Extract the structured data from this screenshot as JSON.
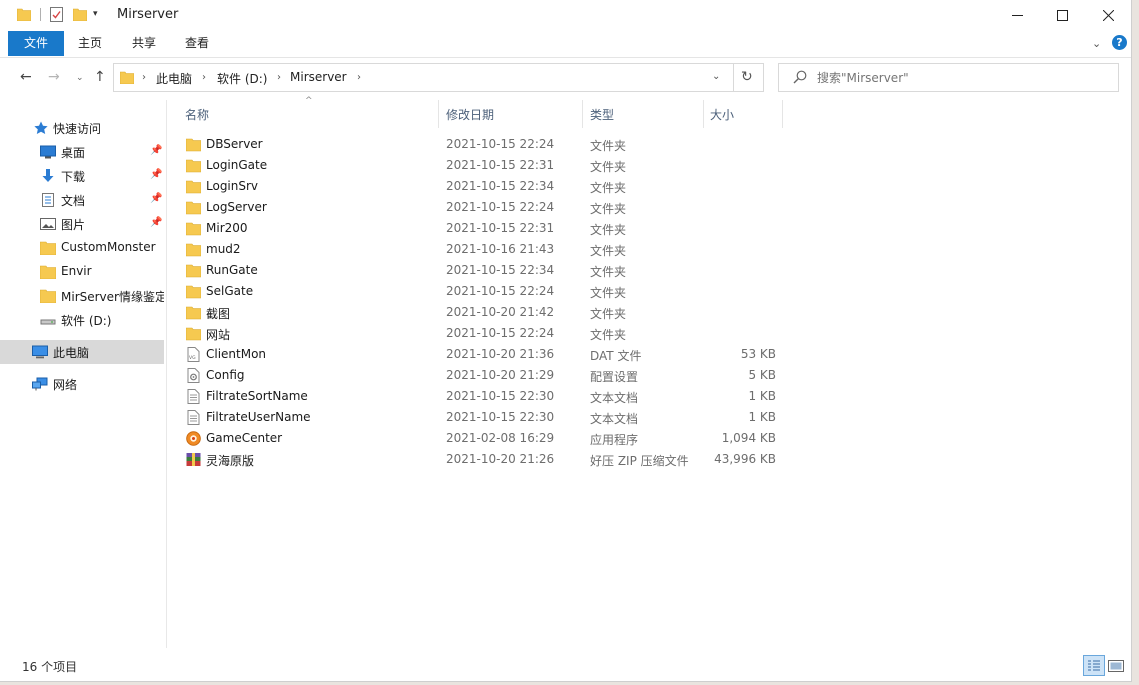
{
  "window": {
    "title": "Mirserver"
  },
  "ribbon": {
    "tabs": [
      "文件",
      "主页",
      "共享",
      "查看"
    ],
    "help_label": "?"
  },
  "address": {
    "crumbs": [
      "此电脑",
      "软件 (D:)",
      "Mirserver"
    ]
  },
  "search": {
    "placeholder": "搜索\"Mirserver\""
  },
  "sidebar": {
    "items": [
      {
        "label": "快速访问",
        "icon": "star-icon"
      },
      {
        "label": "桌面",
        "icon": "desktop-icon",
        "pinned": true
      },
      {
        "label": "下载",
        "icon": "download-icon",
        "pinned": true
      },
      {
        "label": "文档",
        "icon": "document-icon",
        "pinned": true
      },
      {
        "label": "图片",
        "icon": "picture-icon",
        "pinned": true
      },
      {
        "label": "CustomMonster",
        "icon": "folder-icon"
      },
      {
        "label": "Envir",
        "icon": "folder-icon"
      },
      {
        "label": "MirServer情缘鉴定",
        "icon": "folder-icon"
      },
      {
        "label": "软件 (D:)",
        "icon": "drive-icon"
      },
      {
        "label": "此电脑",
        "icon": "computer-icon",
        "selected": true
      },
      {
        "label": "网络",
        "icon": "network-icon"
      }
    ]
  },
  "columns": {
    "name": "名称",
    "date": "修改日期",
    "type": "类型",
    "size": "大小"
  },
  "files": [
    {
      "name": "DBServer",
      "date": "2021-10-15 22:24",
      "type": "文件夹",
      "size": "",
      "icon": "folder-icon"
    },
    {
      "name": "LoginGate",
      "date": "2021-10-15 22:31",
      "type": "文件夹",
      "size": "",
      "icon": "folder-icon"
    },
    {
      "name": "LoginSrv",
      "date": "2021-10-15 22:34",
      "type": "文件夹",
      "size": "",
      "icon": "folder-icon"
    },
    {
      "name": "LogServer",
      "date": "2021-10-15 22:24",
      "type": "文件夹",
      "size": "",
      "icon": "folder-icon"
    },
    {
      "name": "Mir200",
      "date": "2021-10-15 22:31",
      "type": "文件夹",
      "size": "",
      "icon": "folder-icon"
    },
    {
      "name": "mud2",
      "date": "2021-10-16 21:43",
      "type": "文件夹",
      "size": "",
      "icon": "folder-icon"
    },
    {
      "name": "RunGate",
      "date": "2021-10-15 22:34",
      "type": "文件夹",
      "size": "",
      "icon": "folder-icon"
    },
    {
      "name": "SelGate",
      "date": "2021-10-15 22:24",
      "type": "文件夹",
      "size": "",
      "icon": "folder-icon"
    },
    {
      "name": "截图",
      "date": "2021-10-20 21:42",
      "type": "文件夹",
      "size": "",
      "icon": "folder-icon"
    },
    {
      "name": "网站",
      "date": "2021-10-15 22:24",
      "type": "文件夹",
      "size": "",
      "icon": "folder-icon"
    },
    {
      "name": "ClientMon",
      "date": "2021-10-20 21:36",
      "type": "DAT 文件",
      "size": "53 KB",
      "icon": "dat-file-icon"
    },
    {
      "name": "Config",
      "date": "2021-10-20 21:29",
      "type": "配置设置",
      "size": "5 KB",
      "icon": "config-file-icon"
    },
    {
      "name": "FiltrateSortName",
      "date": "2021-10-15 22:30",
      "type": "文本文档",
      "size": "1 KB",
      "icon": "text-file-icon"
    },
    {
      "name": "FiltrateUserName",
      "date": "2021-10-15 22:30",
      "type": "文本文档",
      "size": "1 KB",
      "icon": "text-file-icon"
    },
    {
      "name": "GameCenter",
      "date": "2021-02-08 16:29",
      "type": "应用程序",
      "size": "1,094 KB",
      "icon": "app-icon"
    },
    {
      "name": "灵海原版",
      "date": "2021-10-20 21:26",
      "type": "好压 ZIP 压缩文件",
      "size": "43,996 KB",
      "icon": "zip-archive-icon"
    }
  ],
  "status": {
    "count": "16 个项目"
  },
  "colors": {
    "accent": "#1979ca",
    "folder": "#f6c950",
    "selected_bg": "#d9d9d9"
  }
}
